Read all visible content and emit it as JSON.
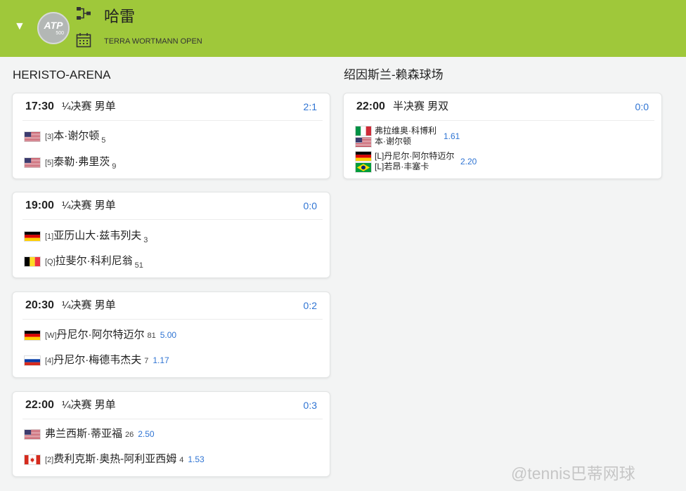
{
  "header": {
    "collapse_glyph": "▼",
    "logo_text": "ATP",
    "logo_sub": "500",
    "tournament": "哈雷",
    "subtitle": "TERRA WORTMANN OPEN",
    "bg_color": "#9fc83a",
    "icons": [
      "bracket-icon",
      "calendar-icon"
    ]
  },
  "venues": [
    {
      "name": "HERISTO-ARENA",
      "matches": [
        {
          "time": "17:30",
          "round": "¼决赛 男单",
          "score": "2:1",
          "players": [
            {
              "flag": "usa",
              "seed": "[3]",
              "name": "本·谢尔顿",
              "rank": "5",
              "odds": ""
            },
            {
              "flag": "usa",
              "seed": "[5]",
              "name": "泰勒·弗里茨",
              "rank": "9",
              "odds": ""
            }
          ]
        },
        {
          "time": "19:00",
          "round": "¼决赛 男单",
          "score": "0:0",
          "players": [
            {
              "flag": "germany",
              "seed": "[1]",
              "name": "亚历山大·兹韦列夫",
              "rank": "3",
              "odds": ""
            },
            {
              "flag": "belgium",
              "seed": "[Q]",
              "name": "拉斐尔·科利尼翁",
              "rank": "51",
              "odds": ""
            }
          ]
        },
        {
          "time": "20:30",
          "round": "¼决赛 男单",
          "score": "0:2",
          "players": [
            {
              "flag": "germany",
              "seed": "[W]",
              "name": "丹尼尔·阿尔特迈尔",
              "rank": "81",
              "odds": "5.00"
            },
            {
              "flag": "russia",
              "seed": "[4]",
              "name": "丹尼尔·梅德韦杰夫",
              "rank": "7",
              "odds": "1.17"
            }
          ]
        },
        {
          "time": "22:00",
          "round": "¼决赛 男单",
          "score": "0:3",
          "players": [
            {
              "flag": "usa",
              "seed": "",
              "name": "弗兰西斯·蒂亚福",
              "rank": "26",
              "odds": "2.50"
            },
            {
              "flag": "canada",
              "seed": "[2]",
              "name": "费利克斯·奥热-阿利亚西姆",
              "rank": "4",
              "odds": "1.53"
            }
          ]
        }
      ]
    },
    {
      "name": "绍因斯兰-赖森球场",
      "matches": [
        {
          "time": "22:00",
          "round": "半决赛 男双",
          "score": "0:0",
          "teams": [
            {
              "flags": [
                "italy",
                "usa"
              ],
              "names": [
                "弗拉维奥·科博利",
                "本·谢尔顿"
              ],
              "odds": "1.61"
            },
            {
              "flags": [
                "germany",
                "brazil"
              ],
              "names": [
                "[L]丹尼尔·阿尔特迈尔",
                "[L]若昂·丰塞卡"
              ],
              "odds": "2.20"
            }
          ]
        }
      ]
    }
  ],
  "watermark": "@tennis巴蒂网球",
  "colors": {
    "accent": "#2f74d3",
    "header": "#9fc83a",
    "background": "#f3f4f4"
  }
}
